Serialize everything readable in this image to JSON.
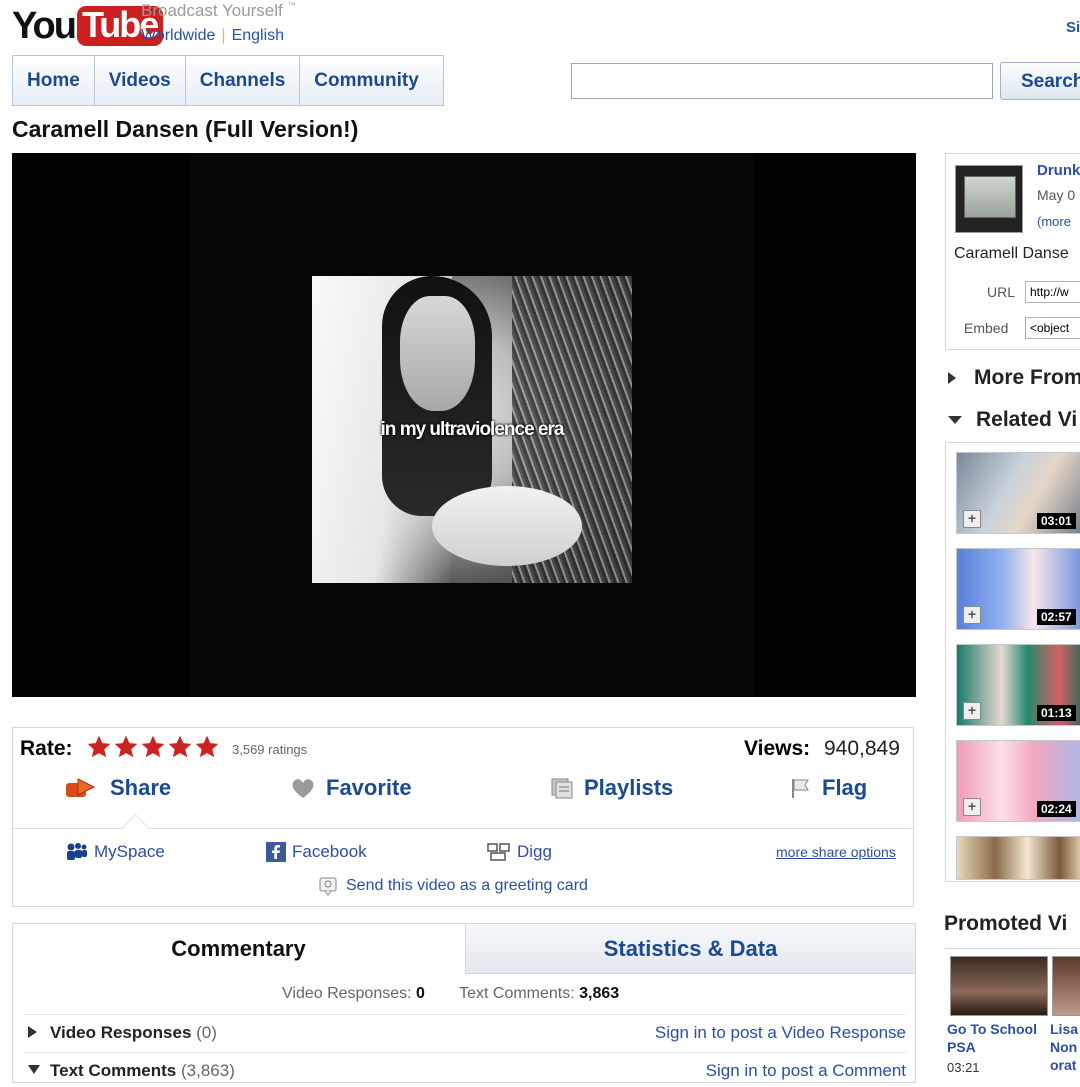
{
  "header": {
    "logo_you": "You",
    "logo_tube": "Tube",
    "tagline": "Broadcast Yourself",
    "tm": "™",
    "region": "Worldwide",
    "language": "English",
    "signin": "Si"
  },
  "nav": {
    "tabs": [
      "Home",
      "Videos",
      "Channels",
      "Community"
    ],
    "search_button": "Search",
    "search_value": ""
  },
  "video": {
    "title": "Caramell Dansen (Full Version!)",
    "caption": "in my ultraviolence era"
  },
  "rating": {
    "label": "Rate:",
    "stars": 5,
    "ratings_text": "3,569 ratings",
    "views_label": "Views:",
    "views_value": "940,849"
  },
  "actions": {
    "share": "Share",
    "favorite": "Favorite",
    "playlists": "Playlists",
    "flag": "Flag"
  },
  "share_services": {
    "myspace": "MySpace",
    "facebook": "Facebook",
    "digg": "Digg",
    "more": "more share options",
    "greeting": "Send this video as a greeting card"
  },
  "tabs": {
    "commentary": "Commentary",
    "stats": "Statistics & Data"
  },
  "stats": {
    "video_responses_label": "Video Responses:",
    "video_responses_value": "0",
    "text_comments_label": "Text Comments:",
    "text_comments_value": "3,863"
  },
  "sections": {
    "video_responses_label": "Video Responses",
    "video_responses_count": "(0)",
    "video_responses_link": "Sign in to post a Video Response",
    "text_comments_label": "Text Comments",
    "text_comments_count": "(3,863)",
    "text_comments_link": "Sign in to post a Comment"
  },
  "sidebar": {
    "uploader": "Drunk",
    "date": "May 0",
    "more": "(more",
    "description": "Caramell Danse",
    "url_label": "URL",
    "url_value": "http://w",
    "embed_label": "Embed",
    "embed_value": "<object",
    "more_from": "More From",
    "related": "Related Vi",
    "related_videos": [
      {
        "duration": "03:01"
      },
      {
        "duration": "02:57"
      },
      {
        "duration": "01:13"
      },
      {
        "duration": "02:24"
      },
      {
        "duration": ""
      }
    ],
    "promoted": "Promoted Vi",
    "promo1_title_a": "Go To School",
    "promo1_title_b": "PSA",
    "promo1_duration": "03:21",
    "promo2_title_a": "Lisa",
    "promo2_title_b": "Non",
    "promo2_title_c": "orat"
  },
  "colors": {
    "link": "#2c4fa0",
    "nav_text": "#1c4a90",
    "logo_red": "#cc1f1f",
    "star": "#cc2222"
  }
}
